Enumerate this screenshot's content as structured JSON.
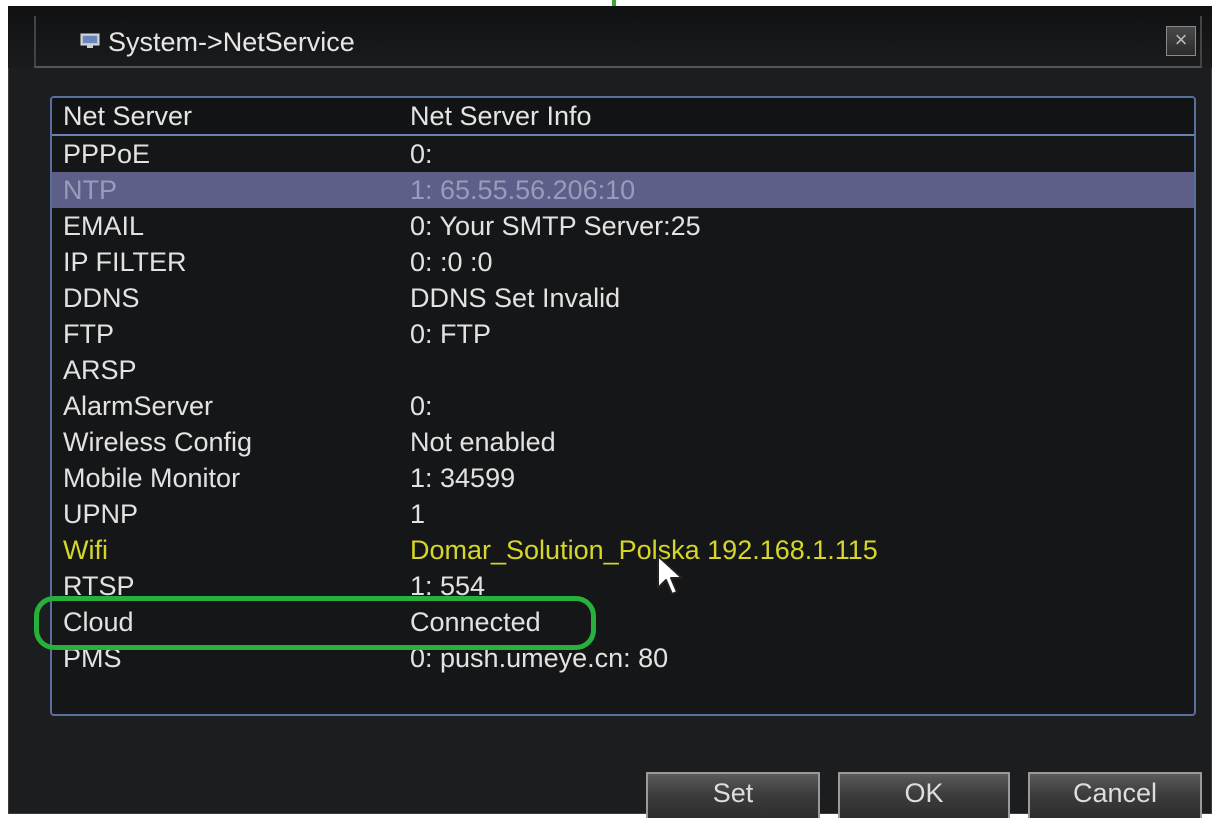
{
  "window": {
    "title": "System->NetService",
    "close_label": "×"
  },
  "table": {
    "headers": [
      "Net Server",
      "Net Server Info"
    ],
    "rows": [
      {
        "server": "PPPoE",
        "info": "0:"
      },
      {
        "server": "NTP",
        "info": "1: 65.55.56.206:10"
      },
      {
        "server": "EMAIL",
        "info": "0: Your SMTP Server:25"
      },
      {
        "server": "IP FILTER",
        "info": "0: :0 :0"
      },
      {
        "server": "DDNS",
        "info": "DDNS Set Invalid"
      },
      {
        "server": "FTP",
        "info": "0: FTP"
      },
      {
        "server": "ARSP",
        "info": ""
      },
      {
        "server": "AlarmServer",
        "info": "0:"
      },
      {
        "server": "Wireless Config",
        "info": "Not enabled"
      },
      {
        "server": "Mobile Monitor",
        "info": "1: 34599"
      },
      {
        "server": "UPNP",
        "info": "1"
      },
      {
        "server": "Wifi",
        "info": "Domar_Solution_Polska 192.168.1.115"
      },
      {
        "server": "RTSP",
        "info": "1: 554"
      },
      {
        "server": "Cloud",
        "info": "Connected"
      },
      {
        "server": "PMS",
        "info": "0: push.umeye.cn: 80"
      }
    ],
    "selected_row": "NTP",
    "highlighted_row": "Wifi"
  },
  "buttons": {
    "set": "Set",
    "ok": "OK",
    "cancel": "Cancel"
  },
  "colors": {
    "selected_row_bg": "#5e5f88",
    "highlight_text": "#d6d62a",
    "annotation_oval": "#27b13c",
    "list_border": "#5a6ea0"
  }
}
